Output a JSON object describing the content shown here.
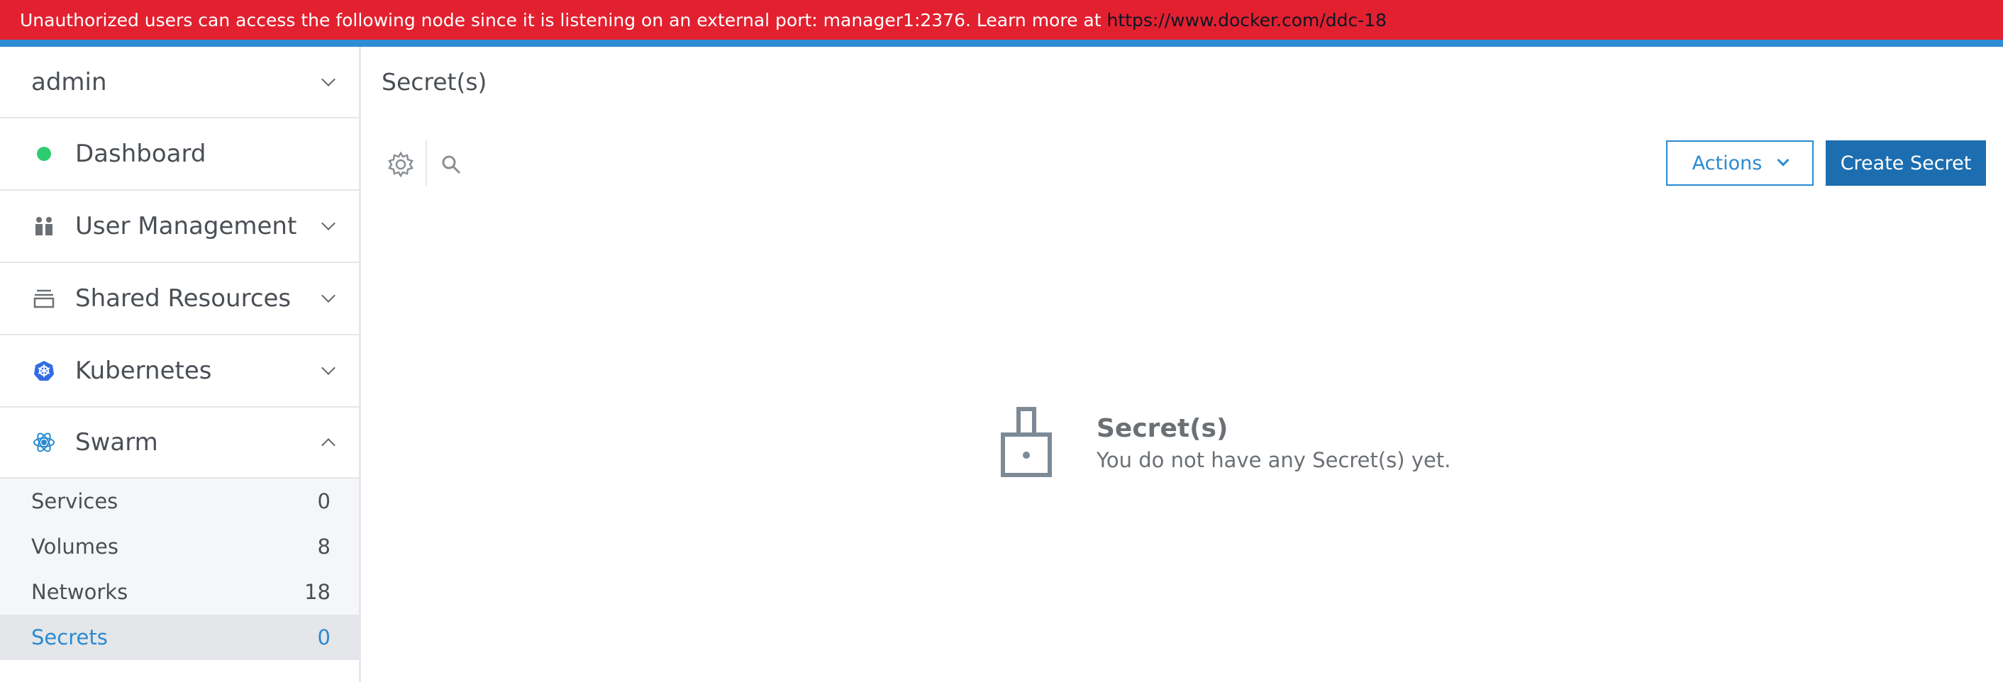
{
  "banner": {
    "message": "Unauthorized users can access the following node since it is listening on an external port: manager1:2376. Learn more at",
    "link": "https://www.docker.com/ddc-18"
  },
  "sidebar": {
    "user": "admin",
    "items": [
      {
        "label": "Dashboard",
        "icon": "status-dot-icon"
      },
      {
        "label": "User Management",
        "icon": "users-icon"
      },
      {
        "label": "Shared Resources",
        "icon": "stack-icon"
      },
      {
        "label": "Kubernetes",
        "icon": "kubernetes-icon"
      },
      {
        "label": "Swarm",
        "icon": "swarm-icon"
      }
    ],
    "swarm_items": [
      {
        "label": "Services",
        "count": "0"
      },
      {
        "label": "Volumes",
        "count": "8"
      },
      {
        "label": "Networks",
        "count": "18"
      },
      {
        "label": "Secrets",
        "count": "0"
      }
    ]
  },
  "main": {
    "title": "Secret(s)",
    "actions_label": "Actions",
    "create_label": "Create Secret",
    "empty_title": "Secret(s)",
    "empty_message": "You do not have any Secret(s) yet."
  },
  "colors": {
    "banner": "#e3202f",
    "accent": "#2a8bd1",
    "primary_button": "#1c6eb0",
    "status_green": "#2ecc71"
  }
}
